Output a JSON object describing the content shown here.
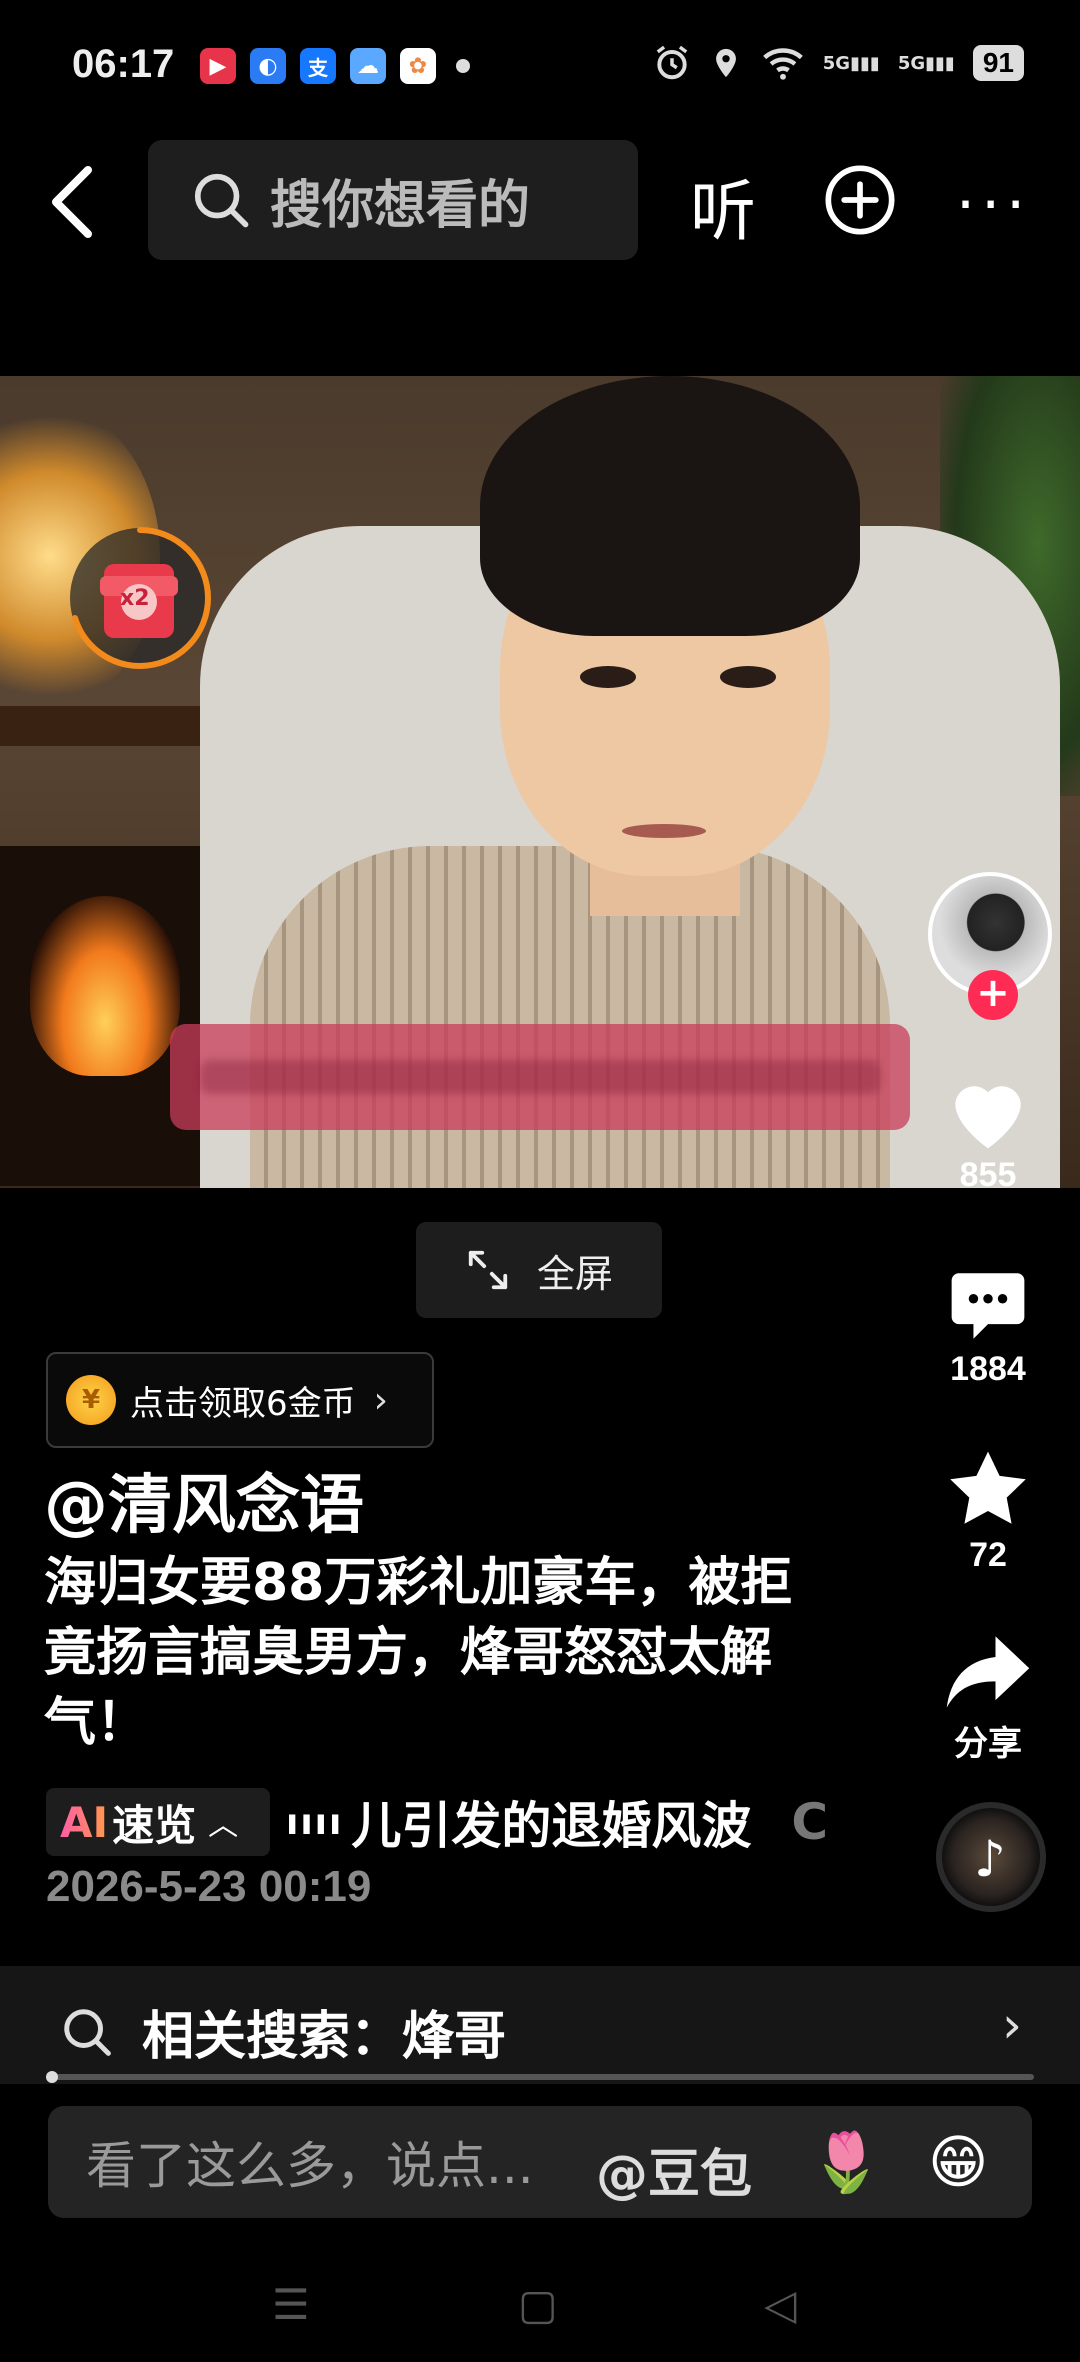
{
  "status_bar": {
    "time": "06:17",
    "battery": "91",
    "network_1": "5G",
    "network_2": "5G"
  },
  "top_nav": {
    "search_placeholder": "搜你想看的",
    "listen_label": "听",
    "more_label": "···"
  },
  "video": {
    "redpack_badge": "x2",
    "fullscreen_label": "全屏"
  },
  "right_rail": {
    "like_count": "855",
    "comment_count": "1884",
    "favorite_count": "72",
    "share_label": "分享"
  },
  "post": {
    "coin_prompt": "点击领取6金币",
    "author": "@清风念语",
    "description": "海归女要88万彩礼加豪车，被拒竟扬言搞臭男方，烽哥怒怼太解气！",
    "ai_logo": "AI",
    "ai_label": "速览",
    "ai_text": "儿引发的退婚风波",
    "ai_trailing": "C",
    "date": "2026-5-23 00:19"
  },
  "related_search": {
    "label": "相关搜索：烽哥"
  },
  "comment": {
    "placeholder": "看了这么多，说点...",
    "mention": "@豆包",
    "emoji_1": "🌷",
    "emoji_2": "😁"
  },
  "colors": {
    "accent": "#fe2c55",
    "background": "#000000",
    "coin": "#f5a623"
  }
}
